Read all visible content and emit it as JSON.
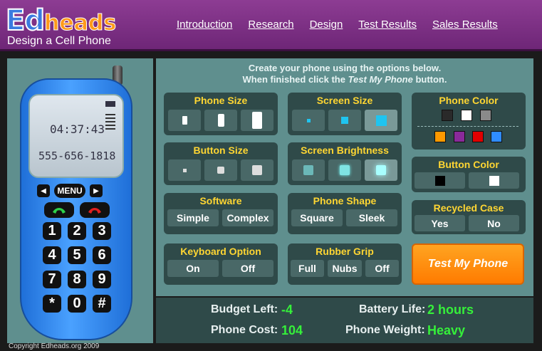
{
  "header": {
    "logo_ed": "Ed",
    "logo_heads": "heads",
    "subtitle": "Design a Cell Phone",
    "nav": [
      "Introduction",
      "Research",
      "Design",
      "Test Results",
      "Sales Results"
    ]
  },
  "phone": {
    "clock": "04:37:43",
    "number": "555-656-1818",
    "menu": "MENU",
    "keys": [
      "1",
      "2",
      "3",
      "4",
      "5",
      "6",
      "7",
      "8",
      "9",
      "*",
      "0",
      "#"
    ],
    "copyright": "Copyright Edheads.org 2009"
  },
  "instructions": {
    "line1": "Create your phone using the options below.",
    "line2_pre": "When finished click the ",
    "line2_em": "Test My Phone",
    "line2_post": " button."
  },
  "groups": {
    "phone_size": {
      "title": "Phone Size"
    },
    "screen_size": {
      "title": "Screen Size"
    },
    "phone_color": {
      "title": "Phone Color",
      "colors_top": [
        "#2a2a2a",
        "#ffffff",
        "#8a8a8a"
      ],
      "colors_bottom": [
        "#ff9900",
        "#8a2a9a",
        "#e00000",
        "#2f8cff"
      ]
    },
    "button_size": {
      "title": "Button Size"
    },
    "screen_brightness": {
      "title": "Screen Brightness"
    },
    "button_color": {
      "title": "Button Color",
      "colors": [
        "#000000",
        "#ffffff"
      ]
    },
    "software": {
      "title": "Software",
      "options": [
        "Simple",
        "Complex"
      ]
    },
    "phone_shape": {
      "title": "Phone Shape",
      "options": [
        "Square",
        "Sleek"
      ]
    },
    "recycled_case": {
      "title": "Recycled Case",
      "options": [
        "Yes",
        "No"
      ]
    },
    "keyboard_option": {
      "title": "Keyboard Option",
      "options": [
        "On",
        "Off"
      ]
    },
    "rubber_grip": {
      "title": "Rubber Grip",
      "options": [
        "Full",
        "Nubs",
        "Off"
      ]
    }
  },
  "test_button": "Test My Phone",
  "stats": {
    "budget_label": "Budget Left:",
    "budget_value": "-4",
    "cost_label": "Phone Cost:",
    "cost_value": "104",
    "battery_label": "Battery Life:",
    "battery_value": "2 hours",
    "weight_label": "Phone Weight:",
    "weight_value": "Heavy"
  }
}
